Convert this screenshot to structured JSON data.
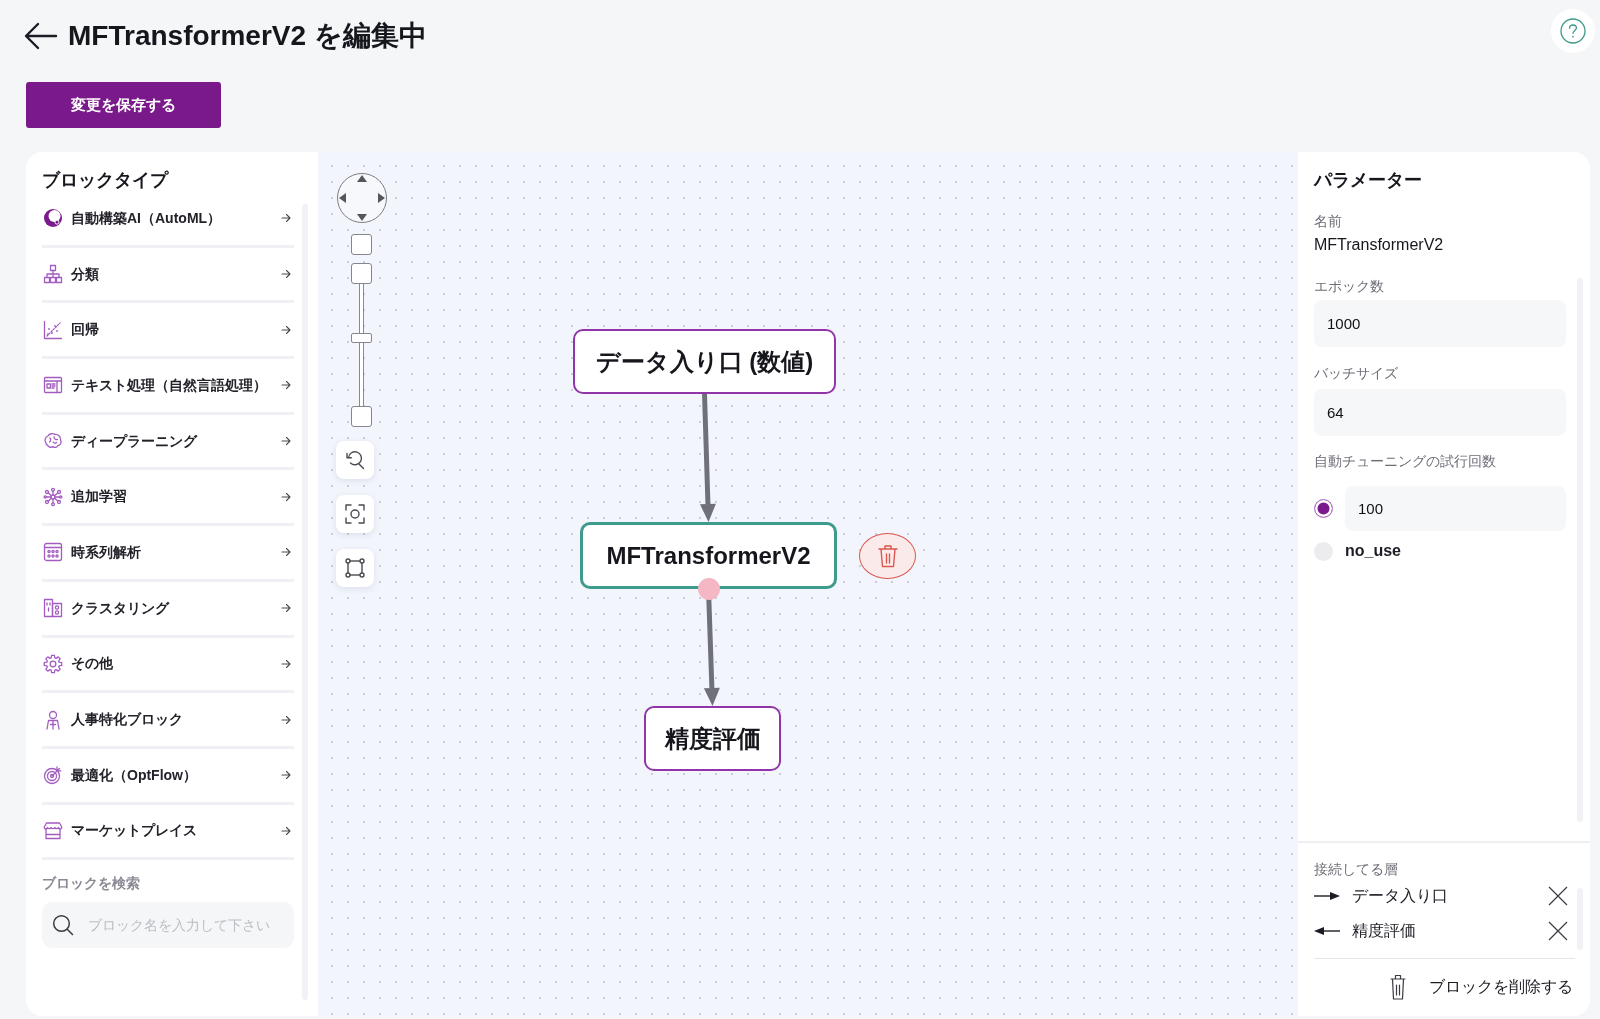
{
  "header": {
    "title": "MFTransformerV2 を編集中"
  },
  "save_button": {
    "label": "変更を保存する"
  },
  "block_types": {
    "title": "ブロックタイプ",
    "items": [
      "自動構築AI（AutoML）",
      "分類",
      "回帰",
      "テキスト処理（自然言語処理）",
      "ディープラーニング",
      "追加学習",
      "時系列解析",
      "クラスタリング",
      "その他",
      "人事特化ブロック",
      "最適化（OptFlow）",
      "マーケットプレイス"
    ]
  },
  "block_search": {
    "label": "ブロックを検索",
    "placeholder": "ブロック名を入力して下さい"
  },
  "canvas": {
    "zoom_slider": {
      "level": 0.55
    },
    "nodes": [
      {
        "label": "データ入り口 (数値)",
        "selected": false
      },
      {
        "label": "MFTransformerV2",
        "selected": true
      },
      {
        "label": "精度評価",
        "selected": false
      }
    ]
  },
  "parameters": {
    "title": "パラメーター",
    "name_label": "名前",
    "name_value": "MFTransformerV2",
    "fields": [
      {
        "label": "エポック数",
        "value": "1000"
      },
      {
        "label": "バッチサイズ",
        "value": "64"
      }
    ],
    "tuning": {
      "label": "自動チューニングの試行回数",
      "options": [
        {
          "kind": "input",
          "value": "100",
          "selected": true
        },
        {
          "kind": "text",
          "label": "no_use",
          "selected": false
        }
      ]
    }
  },
  "connected_layers": {
    "title": "接続してる層",
    "items": [
      {
        "kind": "input",
        "label": "データ入り口"
      },
      {
        "kind": "output",
        "label": "精度評価"
      }
    ]
  },
  "delete_block_button": {
    "label": "ブロックを削除する"
  }
}
